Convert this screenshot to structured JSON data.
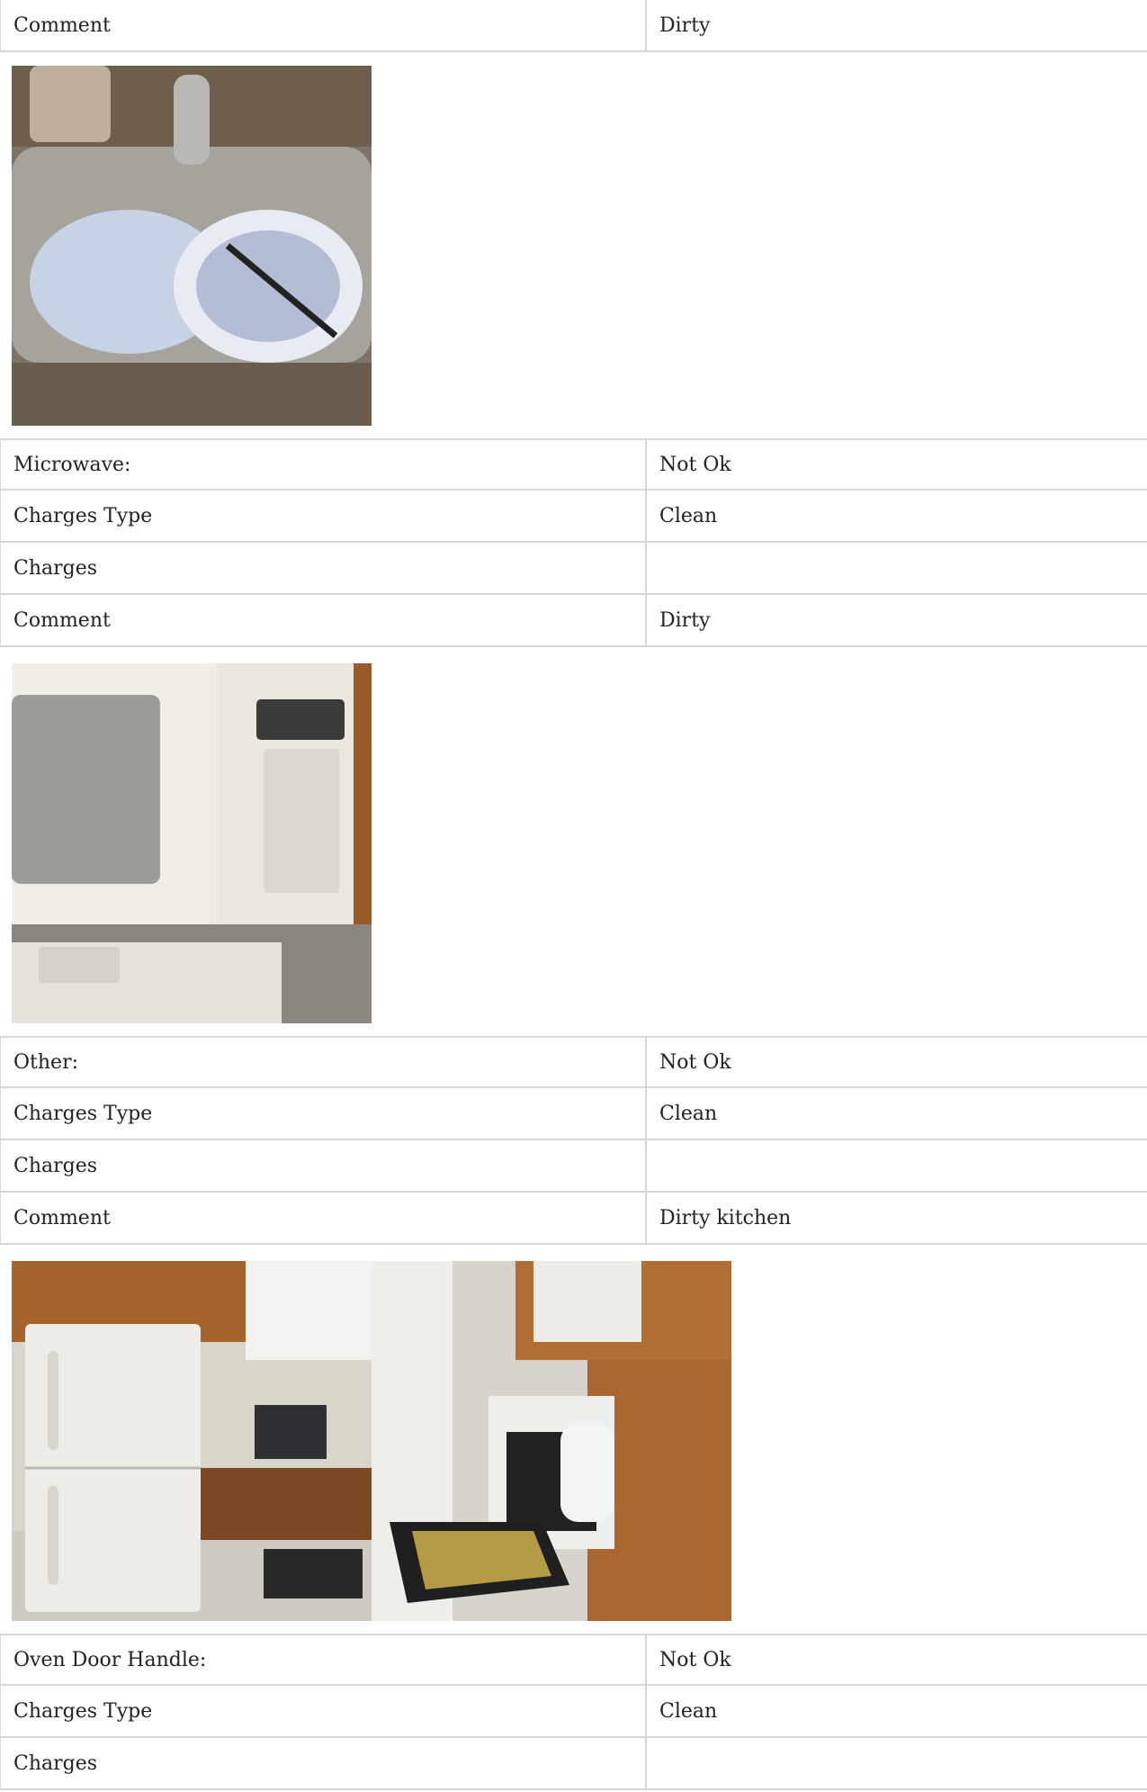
{
  "sections": [
    {
      "rows": [
        {
          "label": "Comment",
          "value": "Dirty"
        }
      ],
      "photos": [
        {
          "alt": "sink-photo",
          "colors": [
            "#8a8178",
            "#c9d5e6"
          ]
        }
      ]
    },
    {
      "rows": [
        {
          "label": "Microwave:",
          "value": "Not Ok"
        },
        {
          "label": "Charges Type",
          "value": "Clean"
        },
        {
          "label": "Charges",
          "value": ""
        },
        {
          "label": "Comment",
          "value": "Dirty"
        }
      ],
      "photos": [
        {
          "alt": "microwave-photo",
          "colors": [
            "#e6e2d8",
            "#9a9a96"
          ]
        }
      ]
    },
    {
      "rows": [
        {
          "label": "Other:",
          "value": "Not Ok"
        },
        {
          "label": "Charges Type",
          "value": "Clean"
        },
        {
          "label": "Charges",
          "value": ""
        },
        {
          "label": "Comment",
          "value": "Dirty kitchen"
        }
      ],
      "photos": [
        {
          "alt": "kitchen-fridge-photo",
          "colors": [
            "#a8672e",
            "#e8e6df"
          ]
        },
        {
          "alt": "kitchen-oven-photo",
          "colors": [
            "#b06f35",
            "#d8d6d0"
          ]
        }
      ]
    },
    {
      "rows": [
        {
          "label": "Oven Door Handle:",
          "value": "Not Ok"
        },
        {
          "label": "Charges Type",
          "value": "Clean"
        },
        {
          "label": "Charges",
          "value": ""
        }
      ]
    }
  ]
}
